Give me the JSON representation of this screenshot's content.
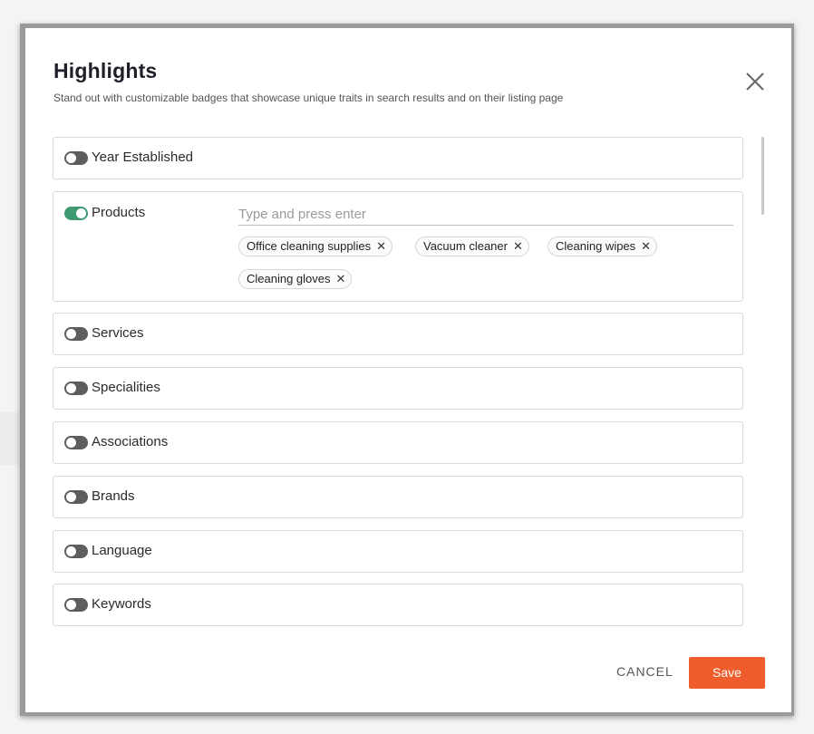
{
  "header": {
    "title": "Highlights",
    "subtitle": "Stand out with customizable badges that showcase unique traits in search results and on their listing page"
  },
  "sections": [
    {
      "label": "Year Established",
      "enabled": false
    },
    {
      "label": "Products",
      "enabled": true
    },
    {
      "label": "Services",
      "enabled": false
    },
    {
      "label": "Specialities",
      "enabled": false
    },
    {
      "label": "Associations",
      "enabled": false
    },
    {
      "label": "Brands",
      "enabled": false
    },
    {
      "label": "Language",
      "enabled": false
    },
    {
      "label": "Keywords",
      "enabled": false
    }
  ],
  "products": {
    "input_placeholder": "Type and press enter",
    "tags": [
      "Office cleaning supplies",
      "Vacuum cleaner",
      "Cleaning wipes",
      "Cleaning gloves"
    ]
  },
  "footer": {
    "cancel_label": "CANCEL",
    "save_label": "Save"
  },
  "icons": {
    "close": "close-icon",
    "chip_remove": "close-icon"
  },
  "colors": {
    "accent": "#ef5d2c",
    "toggle_on": "#3f9a73",
    "toggle_off": "#5d5d5d"
  }
}
